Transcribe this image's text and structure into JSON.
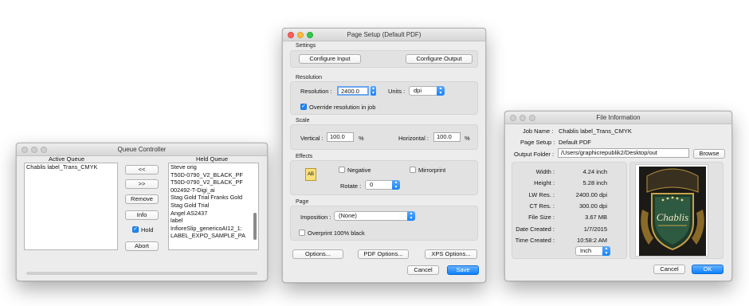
{
  "queue": {
    "title": "Queue Controller",
    "active_header": "Active Queue",
    "held_header": "Held Queue",
    "active_items": [
      "Chablis label_Trans_CMYK"
    ],
    "held_items": [
      "Steve orig",
      "T50D-0790_V2_BLACK_PF",
      "T50D-0790_V2_BLACK_PF",
      "002492-T-Digi_ai",
      "Stag Gold Trial Franks Gold",
      "Stag Gold Trial",
      "Angel AS2437",
      "label",
      "InfioreSlip_genericoAI12_1:",
      "LABEL_EXPO_SAMPLE_PA"
    ],
    "btn_left": "<<",
    "btn_right": ">>",
    "btn_remove": "Remove",
    "btn_info": "Info",
    "hold_label": "Hold",
    "btn_abort": "Abort"
  },
  "setup": {
    "title": "Page Setup (Default PDF)",
    "settings_label": "Settings",
    "configure_input": "Configure Input",
    "configure_output": "Configure Output",
    "resolution_label": "Resolution",
    "resolution_field_label": "Resolution :",
    "resolution_value": "2400.0",
    "units_label": "Units :",
    "units_value": "dpi",
    "override_label": "Override resolution in job",
    "scale_label": "Scale",
    "vertical_label": "Vertical :",
    "vertical_value": "100.0",
    "horizontal_label": "Horizontal :",
    "horizontal_value": "100.0",
    "percent": "%",
    "effects_label": "Effects",
    "effects_icon": "AB",
    "negative_label": "Negative",
    "mirror_label": "Mirrorprint",
    "rotate_label": "Rotate :",
    "rotate_value": "0",
    "page_label": "Page",
    "imposition_label": "Imposition :",
    "imposition_value": "(None)",
    "overprint_label": "Overprint 100% black",
    "options": "Options...",
    "pdf_options": "PDF Options...",
    "xps_options": "XPS Options...",
    "cancel": "Cancel",
    "save": "Save"
  },
  "info": {
    "title": "File Information",
    "job_name_label": "Job Name :",
    "job_name": "Chablis label_Trans_CMYK",
    "page_setup_label": "Page Setup :",
    "page_setup": "Default PDF",
    "output_folder_label": "Output Folder :",
    "output_folder": "/Users/graphicrepublik2/Desktop/out",
    "browse": "Browse",
    "rows": [
      {
        "label": "Width :",
        "value": "4.24 inch"
      },
      {
        "label": "Height :",
        "value": "5.28 inch"
      },
      {
        "label": "LW Res. :",
        "value": "2400.00 dpi"
      },
      {
        "label": "CT Res. :",
        "value": "300.00 dpi"
      },
      {
        "label": "File Size :",
        "value": "3.67 MB"
      },
      {
        "label": "Date Created :",
        "value": "1/7/2015"
      },
      {
        "label": "Time Created :",
        "value": "10:58:2 AM"
      }
    ],
    "unit_select": "Inch",
    "preview_text": "Chablis",
    "cancel": "Cancel",
    "ok": "OK"
  }
}
